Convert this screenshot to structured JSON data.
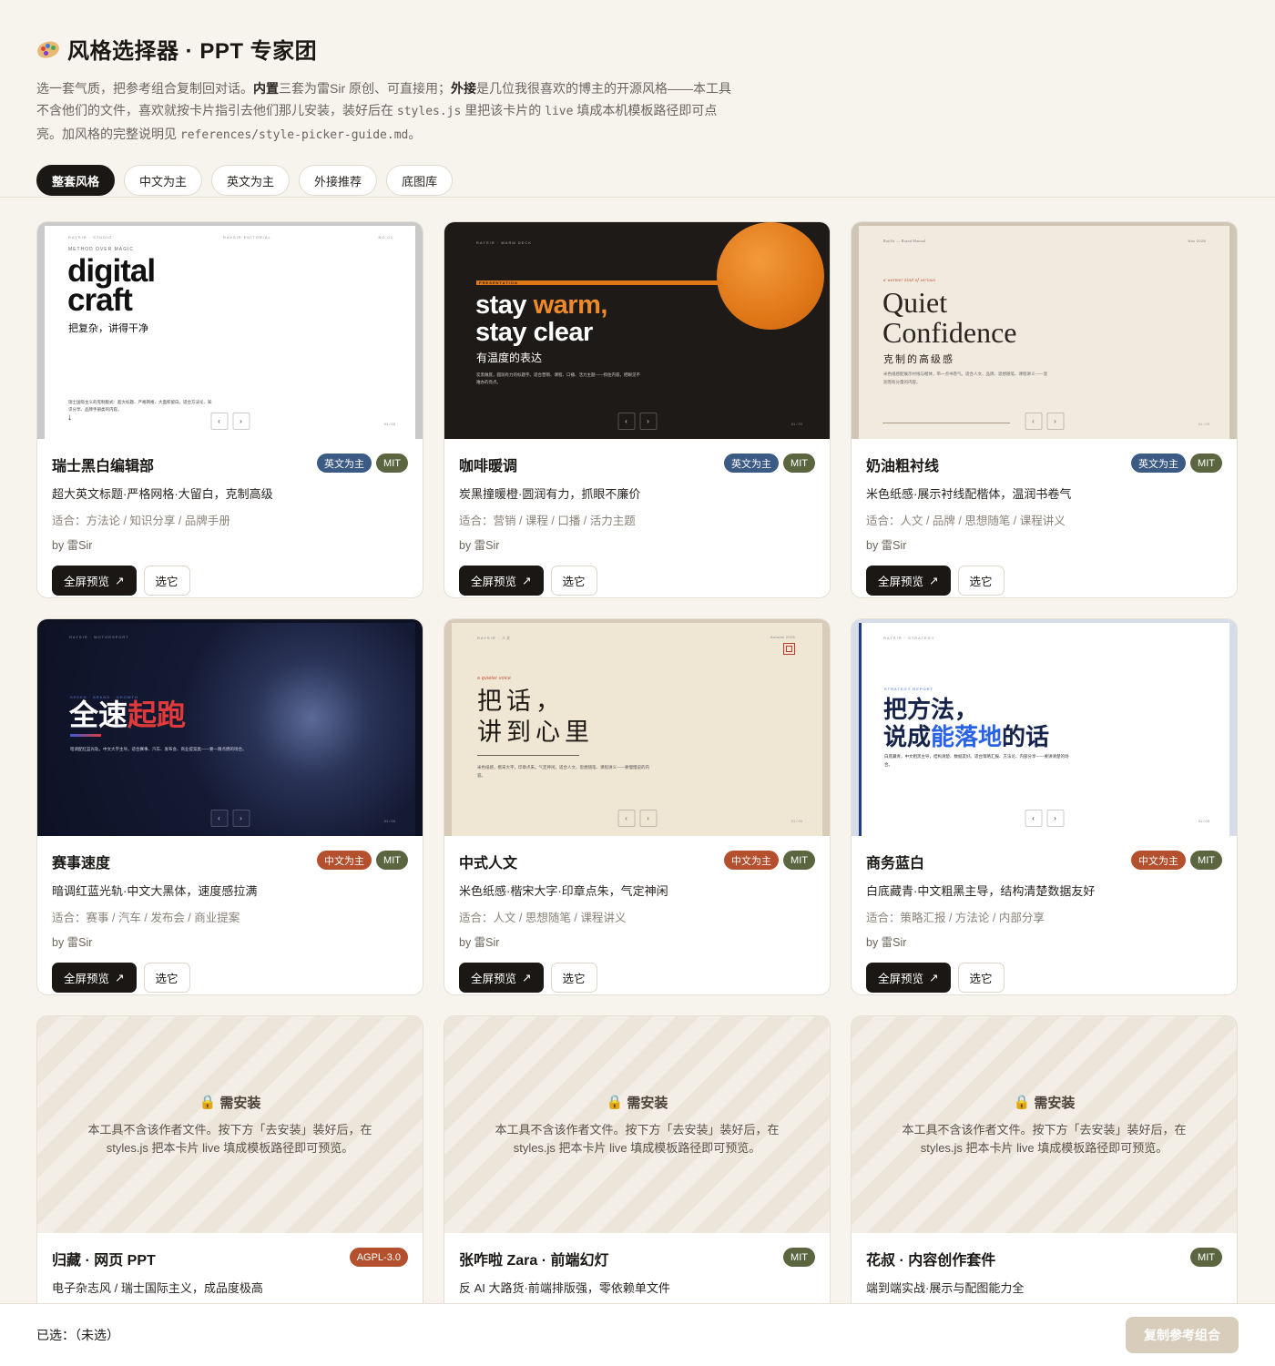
{
  "header": {
    "title": "风格选择器 · PPT 专家团",
    "intro_a": "选一套气质，把参考组合复制回对话。",
    "intro_b": "内置",
    "intro_c": "三套为雷Sir 原创、可直接用；",
    "intro_d": "外接",
    "intro_e": "是几位我很喜欢的博主的开源风格——本工具不含他们的文件，喜欢就按卡片指引去他们那儿安装，装好后在 ",
    "intro_code1": "styles.js",
    "intro_f": " 里把该卡片的 ",
    "intro_code2": "live",
    "intro_g": " 填成本机模板路径即可点亮。加风格的完整说明见 ",
    "intro_code3": "references/style-picker-guide.md",
    "intro_h": "。"
  },
  "tabs": [
    "整套风格",
    "中文为主",
    "英文为主",
    "外接推荐",
    "底图库"
  ],
  "colors": {
    "en_badge": "#3b5a84",
    "zh_badge": "#b4502e",
    "mit_badge": "#5b6640",
    "agpl_badge": "#b4502e",
    "dark_btn": "#1a1714"
  },
  "common": {
    "preview_label": "全屏预览",
    "preview_icon": "arrow-up-right-icon",
    "pick_label": "选它",
    "prev": "‹",
    "next": "›"
  },
  "cards": [
    {
      "name": "瑞士黑白编辑部",
      "lang": "英文为主",
      "license": "MIT",
      "desc": "超大英文标题·严格网格·大留白，克制高级",
      "fit": "适合：方法论 / 知识分享 / 品牌手册",
      "by": "by 雷Sir",
      "thumb": {
        "kicker": "RAYSIR · STUDIO",
        "center": "RAYSIR EDITORIAL",
        "right": "NO.01",
        "eyebrow": "METHOD OVER MAGIC",
        "h1": "digital",
        "h2": "craft",
        "sub": "把复杂，讲得干净",
        "body": "瑞士国际主义的克制版式：超大标题、严格网格、大面积留白。适合方法论、知识分享、品牌手册类的内容。",
        "arrow": "↓",
        "page": "01 / 03"
      }
    },
    {
      "name": "咖啡暖调",
      "lang": "英文为主",
      "license": "MIT",
      "desc": "炭黑撞暖橙·圆润有力，抓眼不廉价",
      "fit": "适合：营销 / 课程 / 口播 / 活力主题",
      "by": "by 雷Sir",
      "thumb": {
        "kicker": "RAYSIR · WARM DECK",
        "tag": "PRESENTATION",
        "h1a": "stay ",
        "h1b": "warm,",
        "h2": "stay clear",
        "sub": "有温度的表达",
        "body": "炭黑做底，圆润有力的标题字。适合营销、课程、口播、活力主题——抓住内容，把眼见不难办的亮点。",
        "page": "01 / 03"
      }
    },
    {
      "name": "奶油粗衬线",
      "lang": "英文为主",
      "license": "MIT",
      "desc": "米色纸感·展示衬线配楷体，温润书卷气",
      "fit": "适合：人文 / 品牌 / 思想随笔 / 课程讲义",
      "by": "by 雷Sir",
      "thumb": {
        "kicker": "RaySir — Brand Manual",
        "right": "Nov 2026",
        "eyebrow": "a warmer kind of serious",
        "h1": "Quiet",
        "h2": "Confidence",
        "sub": "克制的高级感",
        "body": "米色纸感配展示衬线与楷体，带一点书卷气。适合人文、品牌、思想随笔、课程讲义——温润而有分量的内容。",
        "page": "01 / 03"
      }
    },
    {
      "name": "赛事速度",
      "lang": "中文为主",
      "license": "MIT",
      "desc": "暗调红蓝光轨·中文大黑体，速度感拉满",
      "fit": "适合：赛事 / 汽车 / 发布会 / 商业提案",
      "by": "by 雷Sir",
      "thumb": {
        "kicker": "RAYSIR · MOTORSPORT",
        "eyebrow": "SPEED · BRAND · GROWTH",
        "h1a": "全速",
        "h1b": "起跑",
        "body": "暗调配红蓝光轨，中文大字主导。适合赛事、汽车、发布会、商业提案类——要一眼点燃的场合。",
        "page": "01 / 03"
      }
    },
    {
      "name": "中式人文",
      "lang": "中文为主",
      "license": "MIT",
      "desc": "米色纸感·楷宋大字·印章点朱，气定神闲",
      "fit": "适合：人文 / 思想随笔 / 课程讲义",
      "by": "by 雷Sir",
      "thumb": {
        "kicker": "RAYSIR · 人文",
        "right": "Autumn 2026",
        "eyebrow": "a quieter voice",
        "h1": "把话，",
        "h2": "讲到心里",
        "body": "米色纸感，楷宋大字，印章点朱。气定神闲，适合人文、思想随笔、课程讲义——要慢慢说的内容。",
        "page": "01 / 03"
      }
    },
    {
      "name": "商务蓝白",
      "lang": "中文为主",
      "license": "MIT",
      "desc": "白底藏青·中文粗黑主导，结构清楚数据友好",
      "fit": "适合：策略汇报 / 方法论 / 内部分享",
      "by": "by 雷Sir",
      "thumb": {
        "kicker": "RAYSIR · STRATEGY",
        "eyebrow": "STRATEGY REPORT",
        "h1": "把方法，",
        "h2a": "说成",
        "h2b": "能落地",
        "h2c": "的话",
        "body": "白底藏青，中文粗黑主导，结构清楚、数据友好。适合策略汇报、方法论、内部分享——要讲清楚的场合。",
        "page": "01 / 03"
      }
    },
    {
      "name": "归藏 · 网页 PPT",
      "lang": "",
      "license": "AGPL-3.0",
      "desc": "电子杂志风 / 瑞士国际主义，成品度极高",
      "fit": "",
      "by": ""
    },
    {
      "name": "张咋啦 Zara · 前端幻灯",
      "lang": "",
      "license": "MIT",
      "desc": "反 AI 大路货·前端排版强，零依赖单文件",
      "fit": "",
      "by": ""
    },
    {
      "name": "花叔 · 内容创作套件",
      "lang": "",
      "license": "MIT",
      "desc": "端到端实战·展示与配图能力全",
      "fit": "",
      "by": ""
    }
  ],
  "locked": {
    "title": "需安装",
    "icon": "lock-icon",
    "line1": "本工具不含该作者文件。按下方「去安装」装好后，在",
    "line2": "styles.js 把本卡片 live 填成模板路径即可预览。"
  },
  "bottom": {
    "selected": "已选：（未选）",
    "copy": "复制参考组合"
  }
}
